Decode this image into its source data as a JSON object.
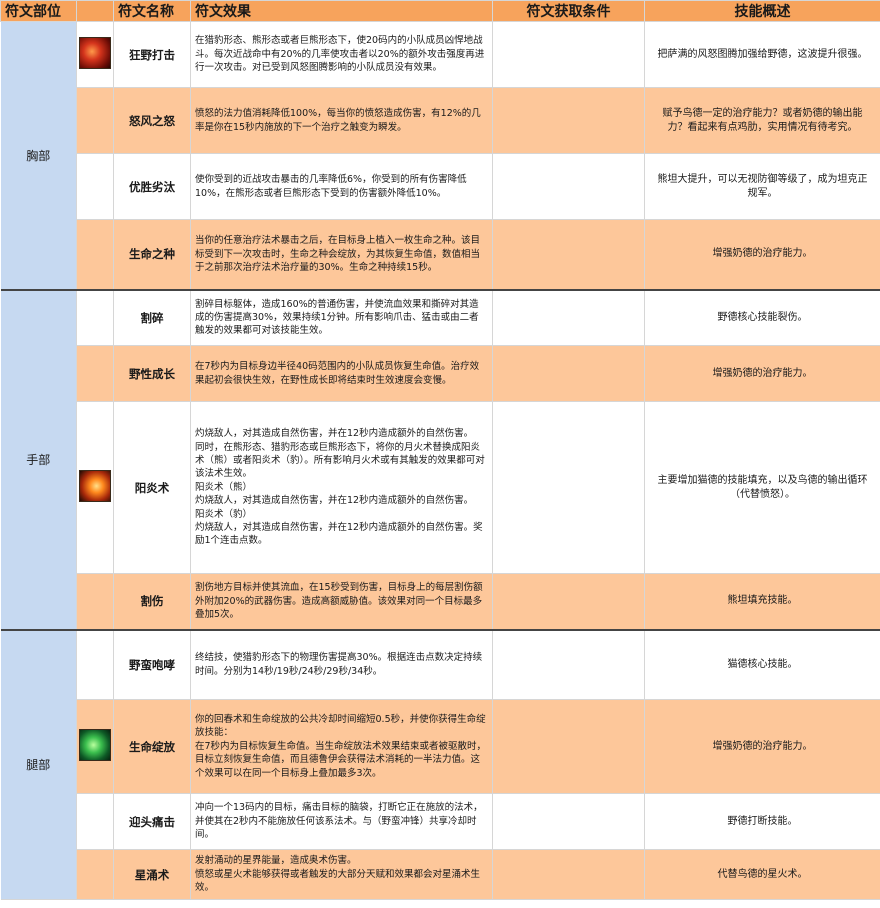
{
  "headers": {
    "part": "符文部位",
    "name": "符文名称",
    "effect": "符文效果",
    "condition": "符文获取条件",
    "summary": "技能概述"
  },
  "sections": [
    {
      "part": "胸部",
      "runes": [
        {
          "name": "狂野打击",
          "icon": "feral-rune-icon",
          "effect": "在猎豹形态、熊形态或者巨熊形态下，使20码内的小队成员凶悍地战斗。每次近战命中有20%的几率使攻击者以20%的额外攻击强度再进行一次攻击。对已受到风怒图腾影响的小队成员没有效果。",
          "condition": "",
          "summary": "把萨满的风怒图腾加强给野德，这波提升很强。"
        },
        {
          "name": "怒风之怒",
          "effect": "愤怒的法力值消耗降低100%，每当你的愤怒造成伤害，有12%的几率是你在15秒内施放的下一个治疗之触变为瞬发。",
          "condition": "",
          "summary": "赋予鸟德一定的治疗能力？或者奶德的输出能力？看起来有点鸡肋，实用情况有待考究。"
        },
        {
          "name": "优胜劣汰",
          "effect": "使你受到的近战攻击暴击的几率降低6%，你受到的所有伤害降低10%，在熊形态或者巨熊形态下受到的伤害额外降低10%。",
          "condition": "",
          "summary": "熊坦大提升，可以无视防御等级了，成为坦克正规军。"
        },
        {
          "name": "生命之种",
          "effect": "当你的任意治疗法术暴击之后，在目标身上植入一枚生命之种。该目标受到下一次攻击时，生命之种会绽放，为其恢复生命值，数值相当于之前那次治疗法术治疗量的30%。生命之种持续15秒。",
          "condition": "",
          "summary": "增强奶德的治疗能力。"
        }
      ]
    },
    {
      "part": "手部",
      "runes": [
        {
          "name": "割碎",
          "effect": "割碎目标躯体，造成160%的普通伤害，并使流血效果和撕碎对其造成的伤害提高30%，效果持续1分钟。所有影响爪击、猛击或由二者触发的效果都可对该技能生效。",
          "condition": "",
          "summary": "野德核心技能裂伤。"
        },
        {
          "name": "野性成长",
          "effect": "在7秒内为目标身边半径40码范围内的小队成员恢复生命值。治疗效果起初会很快生效，在野性成长即将结束时生效速度会变慢。",
          "condition": "",
          "summary": "增强奶德的治疗能力。"
        },
        {
          "name": "阳炎术",
          "icon": "sunfire-rune-icon",
          "effect": "灼烧敌人，对其造成自然伤害，并在12秒内造成额外的自然伤害。\n同时，在熊形态、猎豹形态或巨熊形态下，将你的月火术替换成阳炎术（熊）或者阳炎术（豹）。所有影响月火术或有其触发的效果都可对该法术生效。\n阳炎术（熊）\n灼烧敌人，对其造成自然伤害，并在12秒内造成额外的自然伤害。\n阳炎术（豹）\n灼烧敌人，对其造成自然伤害，并在12秒内造成额外的自然伤害。奖励1个连击点数。",
          "condition": "",
          "summary": "主要增加猫德的技能填充，以及鸟德的输出循环（代替愤怒）。"
        },
        {
          "name": "割伤",
          "effect": "割伤地方目标并使其流血，在15秒受到伤害，目标身上的每层割伤额外附加20%的武器伤害。造成高额威胁值。该效果对同一个目标最多叠加5次。",
          "condition": "",
          "summary": "熊坦填充技能。"
        }
      ]
    },
    {
      "part": "腿部",
      "runes": [
        {
          "name": "野蛮咆哮",
          "effect": "终结技，使猎豹形态下的物理伤害提高30%。根据连击点数决定持续时间。分别为14秒/19秒/24秒/29秒/34秒。",
          "condition": "",
          "summary": "猫德核心技能。"
        },
        {
          "name": "生命绽放",
          "icon": "lifebloom-rune-icon",
          "effect": "你的回春术和生命绽放的公共冷却时间缩短0.5秒，并使你获得生命绽放技能：\n在7秒内为目标恢复生命值。当生命绽放法术效果结束或者被驱散时，目标立刻恢复生命值，而且德鲁伊会获得法术消耗的一半法力值。这个效果可以在同一个目标身上叠加最多3次。",
          "condition": "",
          "summary": "增强奶德的治疗能力。"
        },
        {
          "name": "迎头痛击",
          "effect": "冲向一个13码内的目标，痛击目标的脑袋，打断它正在施放的法术，并使其在2秒内不能施放任何该系法术。与（野蛮冲锋）共享冷却时间。",
          "condition": "",
          "summary": "野德打断技能。"
        },
        {
          "name": "星涌术",
          "effect": "发射涌动的星界能量，造成奥术伤害。\n愤怒或星火术能够获得或者触发的大部分天赋和效果都会对星涌术生效。",
          "condition": "",
          "summary": "代替鸟德的星火术。"
        }
      ]
    }
  ]
}
